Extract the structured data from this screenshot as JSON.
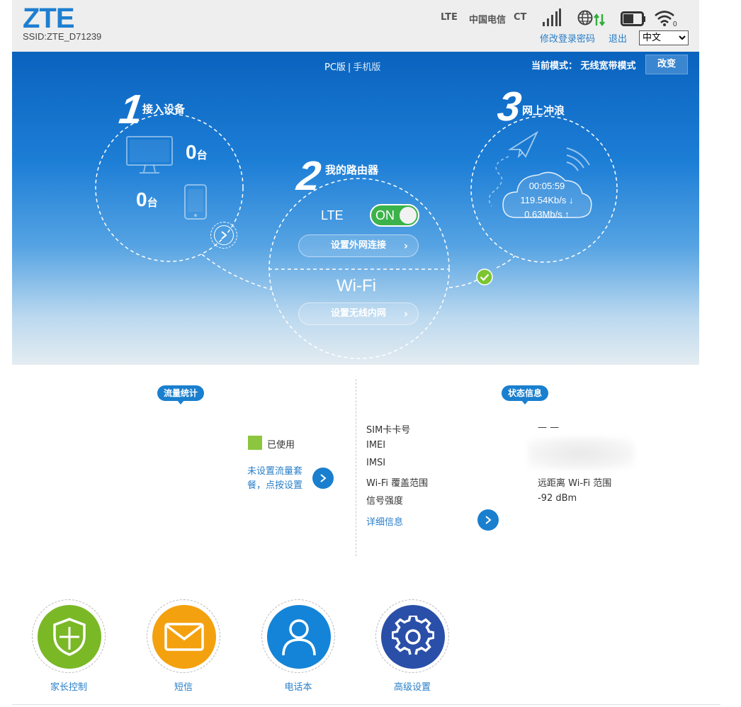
{
  "header": {
    "logo": "ZTE",
    "ssid": "SSID:ZTE_D71239",
    "network_type": "LTE",
    "operator": "中国电信",
    "operator_code": "CT",
    "change_password": "修改登录密码",
    "logout": "退出",
    "language": "中文"
  },
  "hero": {
    "version_pc": "PC版",
    "version_separator": "|",
    "version_mobile": "手机版",
    "mode_label": "当前模式：",
    "mode_value": "无线宽带模式",
    "mode_change": "改变",
    "step1": {
      "number": "1",
      "title": "接入设备",
      "pc_count": "0",
      "mobile_count": "0",
      "unit": "台"
    },
    "step2": {
      "number": "2",
      "title": "我的路由器",
      "lte_label": "LTE",
      "toggle_state": "ON",
      "wan_button": "设置外网连接",
      "wifi_label": "Wi-Fi",
      "lan_button": "设置无线内网"
    },
    "step3": {
      "number": "3",
      "title": "网上冲浪",
      "duration": "00:05:59",
      "download": "119.54Kb/s ↓",
      "upload": "0.63Mb/s ↑"
    }
  },
  "traffic": {
    "title": "流量统计",
    "legend_used": "已使用",
    "plan_link": "未设置流量套餐，点按设置"
  },
  "status": {
    "title": "状态信息",
    "rows": [
      {
        "key": "SIM卡卡号",
        "value": "— —"
      },
      {
        "key": "IMEI",
        "value": ""
      },
      {
        "key": "IMSI",
        "value": ""
      },
      {
        "key": "Wi-Fi 覆盖范围",
        "value": "远距离 Wi-Fi 范围"
      },
      {
        "key": "信号强度",
        "value": "-92 dBm"
      }
    ],
    "details_link": "详细信息"
  },
  "apps": [
    {
      "label": "家长控制",
      "color": "#7ab826"
    },
    {
      "label": "短信",
      "color": "#f4a10f"
    },
    {
      "label": "电话本",
      "color": "#1484d8"
    },
    {
      "label": "高级设置",
      "color": "#2a4fa8"
    }
  ],
  "colors": {
    "brand": "#1e7fd0",
    "link": "#2a7fc8",
    "toggle_on": "#3cb34a",
    "check": "#7cc531"
  }
}
